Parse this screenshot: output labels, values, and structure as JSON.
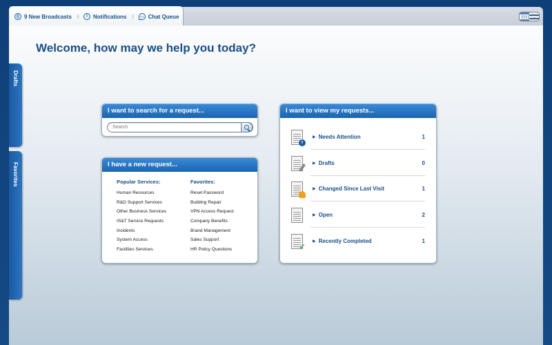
{
  "tabs": [
    {
      "label": "9 New Broadcasts",
      "icon": "broadcast-icon"
    },
    {
      "label": "Notifications",
      "icon": "notification-icon"
    },
    {
      "label": "Chat Queue",
      "icon": "chat-icon"
    }
  ],
  "welcome": "Welcome, how may we help you today?",
  "side_tabs": {
    "drafts": "Drafts",
    "favorites": "Favorites"
  },
  "search_panel": {
    "title": "I want to search for a request...",
    "placeholder": "Search"
  },
  "new_request_panel": {
    "title": "I have a new request...",
    "popular_heading": "Popular Services:",
    "popular": [
      "Human Resources",
      "R&D Support Services",
      "Other Business Services",
      "IS&T Service Requests",
      "Incidents",
      "System Access",
      "Facilities Services"
    ],
    "favorites_heading": "Favorites:",
    "favorites": [
      "Reset Password",
      "Building Repair",
      "VPN Access Request",
      "Company Benefits",
      "Brand Management",
      "Sales Support",
      "HR Policy Questions"
    ]
  },
  "requests_panel": {
    "title": "I want to view my requests...",
    "items": [
      {
        "label": "Needs Attention",
        "count": "1",
        "icon": "info-document-icon"
      },
      {
        "label": "Drafts",
        "count": "0",
        "icon": "draft-document-icon"
      },
      {
        "label": "Changed Since Last Visit",
        "count": "1",
        "icon": "changed-document-icon"
      },
      {
        "label": "Open",
        "count": "2",
        "icon": "open-document-icon"
      },
      {
        "label": "Recently Completed",
        "count": "1",
        "icon": "completed-document-icon"
      }
    ]
  },
  "colors": {
    "accent": "#1a63b0",
    "heading": "#1a4e86",
    "frame": "#0f3f78"
  }
}
